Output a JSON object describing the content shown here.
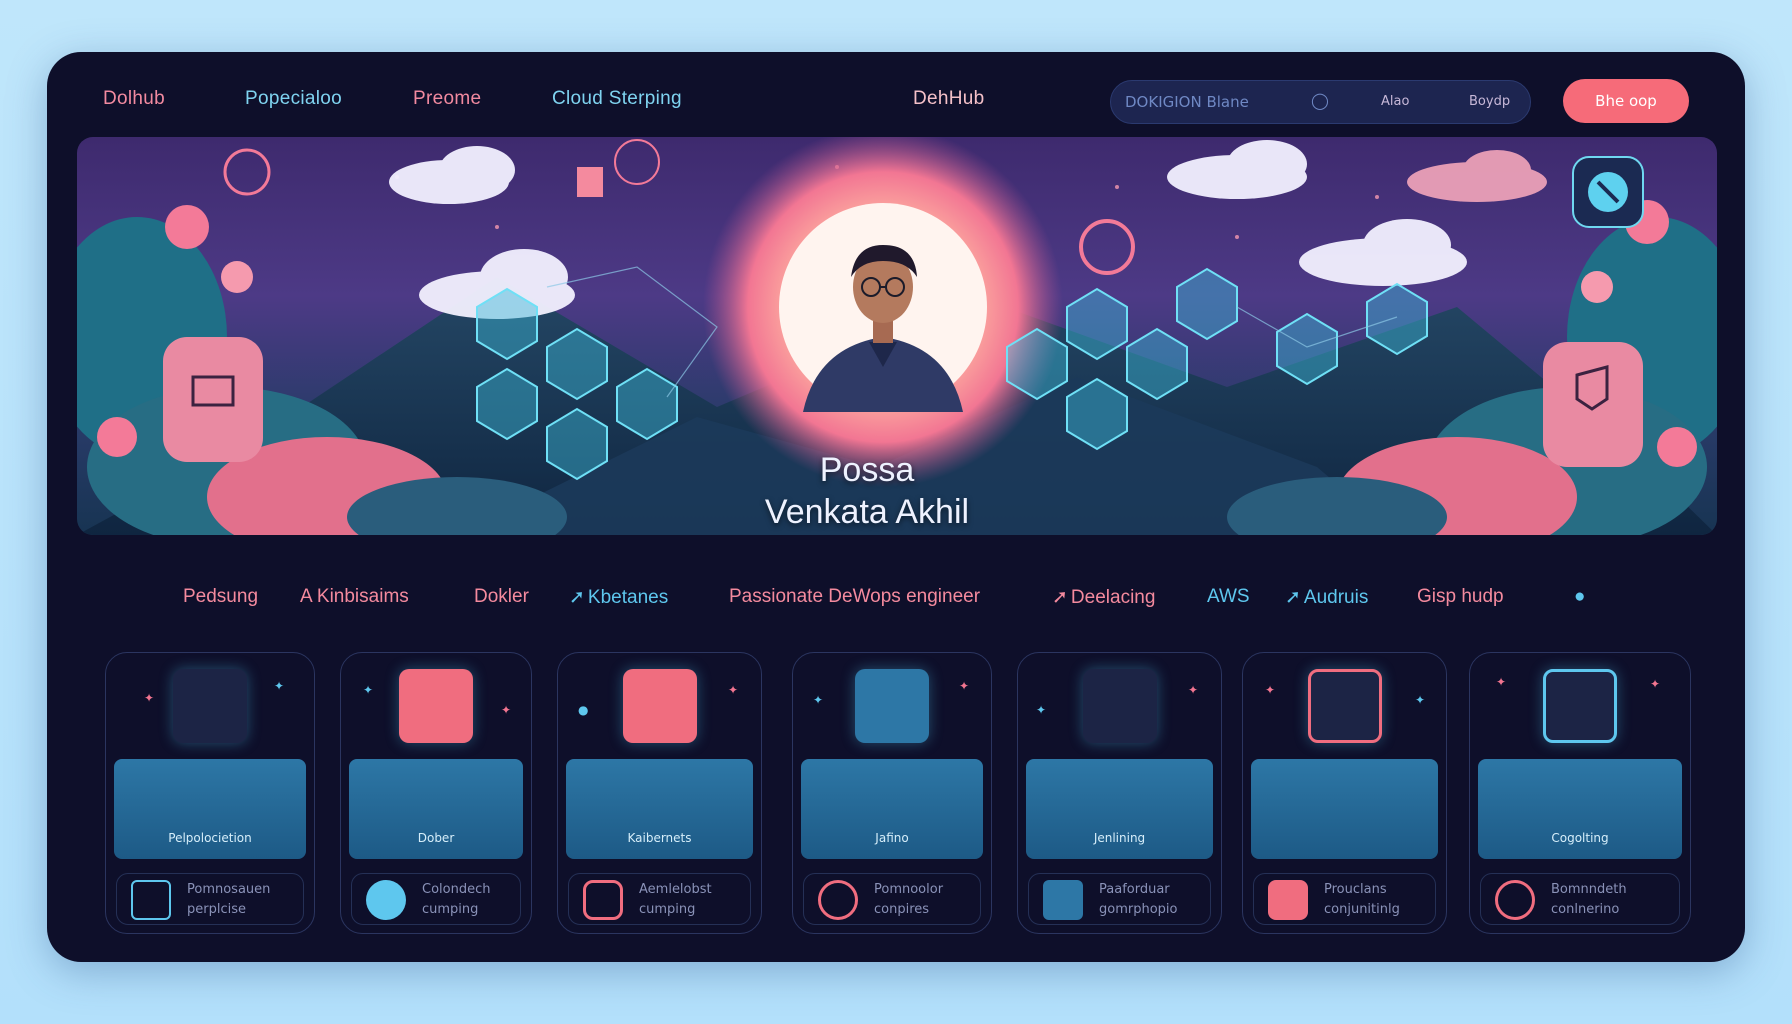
{
  "nav": {
    "links": [
      "Dolhub",
      "Popecialoo",
      "Preome",
      "Cloud Sterping"
    ],
    "center_title": "DehHub",
    "search": {
      "text": "DOKIGION Blane",
      "options": [
        "Alao",
        "Boydp"
      ]
    },
    "cta_label": "Bhe oop"
  },
  "hero": {
    "name_line1": "Possa",
    "name_line2": "Venkata Akhil"
  },
  "tagline": [
    {
      "text": "Pedsung",
      "color": "pink"
    },
    {
      "text": "A Kinbisaims",
      "color": "pink"
    },
    {
      "text": "Dokler",
      "color": "pink"
    },
    {
      "text": "Kbetanes",
      "color": "blue",
      "marker": true
    },
    {
      "text": "Passionate DeWops engineer",
      "color": "pink"
    },
    {
      "text": "Deelacing",
      "color": "pink",
      "marker": true
    },
    {
      "text": "AWS",
      "color": "blue"
    },
    {
      "text": "Audruis",
      "color": "blue",
      "marker": true
    },
    {
      "text": "Gisp hudp",
      "color": "pink"
    }
  ],
  "cards": [
    {
      "skill": "Pelpolocietion",
      "foot_line1": "Pomnosauen",
      "foot_line2": "perplcise"
    },
    {
      "skill": "Dober",
      "foot_line1": "Colondech",
      "foot_line2": "cumping"
    },
    {
      "skill": "Kaibernets",
      "foot_line1": "Aemlelobst",
      "foot_line2": "cumping"
    },
    {
      "skill": "Jafino",
      "foot_line1": "Pomnoolor",
      "foot_line2": "conpires"
    },
    {
      "skill": "Jenlining",
      "foot_line1": "Paaforduar",
      "foot_line2": "gomrphopio"
    },
    {
      "skill": "",
      "foot_line1": "Prouclans",
      "foot_line2": "conjunitinlg"
    },
    {
      "skill": "Cogolting",
      "foot_line1": "Bomnndeth",
      "foot_line2": "conlnerino"
    }
  ],
  "colors": {
    "frame_bg": "#0e0f2a",
    "accent_pink": "#f48a9e",
    "accent_blue": "#5ec7ee",
    "cta": "#f66b79"
  }
}
